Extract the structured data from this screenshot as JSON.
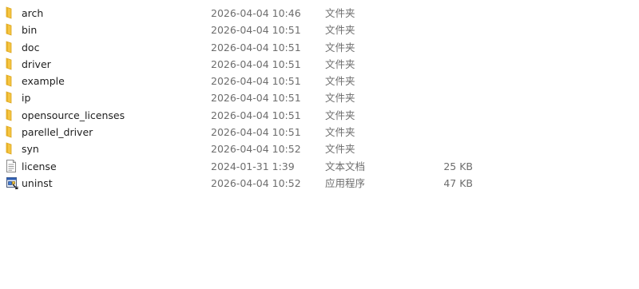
{
  "files": [
    {
      "name": "arch",
      "date": "2026-04-04 10:46",
      "type": "文件夹",
      "size": "",
      "icon": "folder-icon"
    },
    {
      "name": "bin",
      "date": "2026-04-04 10:51",
      "type": "文件夹",
      "size": "",
      "icon": "folder-icon"
    },
    {
      "name": "doc",
      "date": "2026-04-04 10:51",
      "type": "文件夹",
      "size": "",
      "icon": "folder-icon"
    },
    {
      "name": "driver",
      "date": "2026-04-04 10:51",
      "type": "文件夹",
      "size": "",
      "icon": "folder-icon"
    },
    {
      "name": "example",
      "date": "2026-04-04 10:51",
      "type": "文件夹",
      "size": "",
      "icon": "folder-icon"
    },
    {
      "name": "ip",
      "date": "2026-04-04 10:51",
      "type": "文件夹",
      "size": "",
      "icon": "folder-icon"
    },
    {
      "name": "opensource_licenses",
      "date": "2026-04-04 10:51",
      "type": "文件夹",
      "size": "",
      "icon": "folder-icon"
    },
    {
      "name": "parellel_driver",
      "date": "2026-04-04 10:51",
      "type": "文件夹",
      "size": "",
      "icon": "folder-icon"
    },
    {
      "name": "syn",
      "date": "2026-04-04 10:52",
      "type": "文件夹",
      "size": "",
      "icon": "folder-icon"
    },
    {
      "name": "license",
      "date": "2024-01-31 1:39",
      "type": "文本文档",
      "size": "25 KB",
      "icon": "text-document-icon"
    },
    {
      "name": "uninst",
      "date": "2026-04-04 10:52",
      "type": "应用程序",
      "size": "47 KB",
      "icon": "application-icon"
    }
  ]
}
